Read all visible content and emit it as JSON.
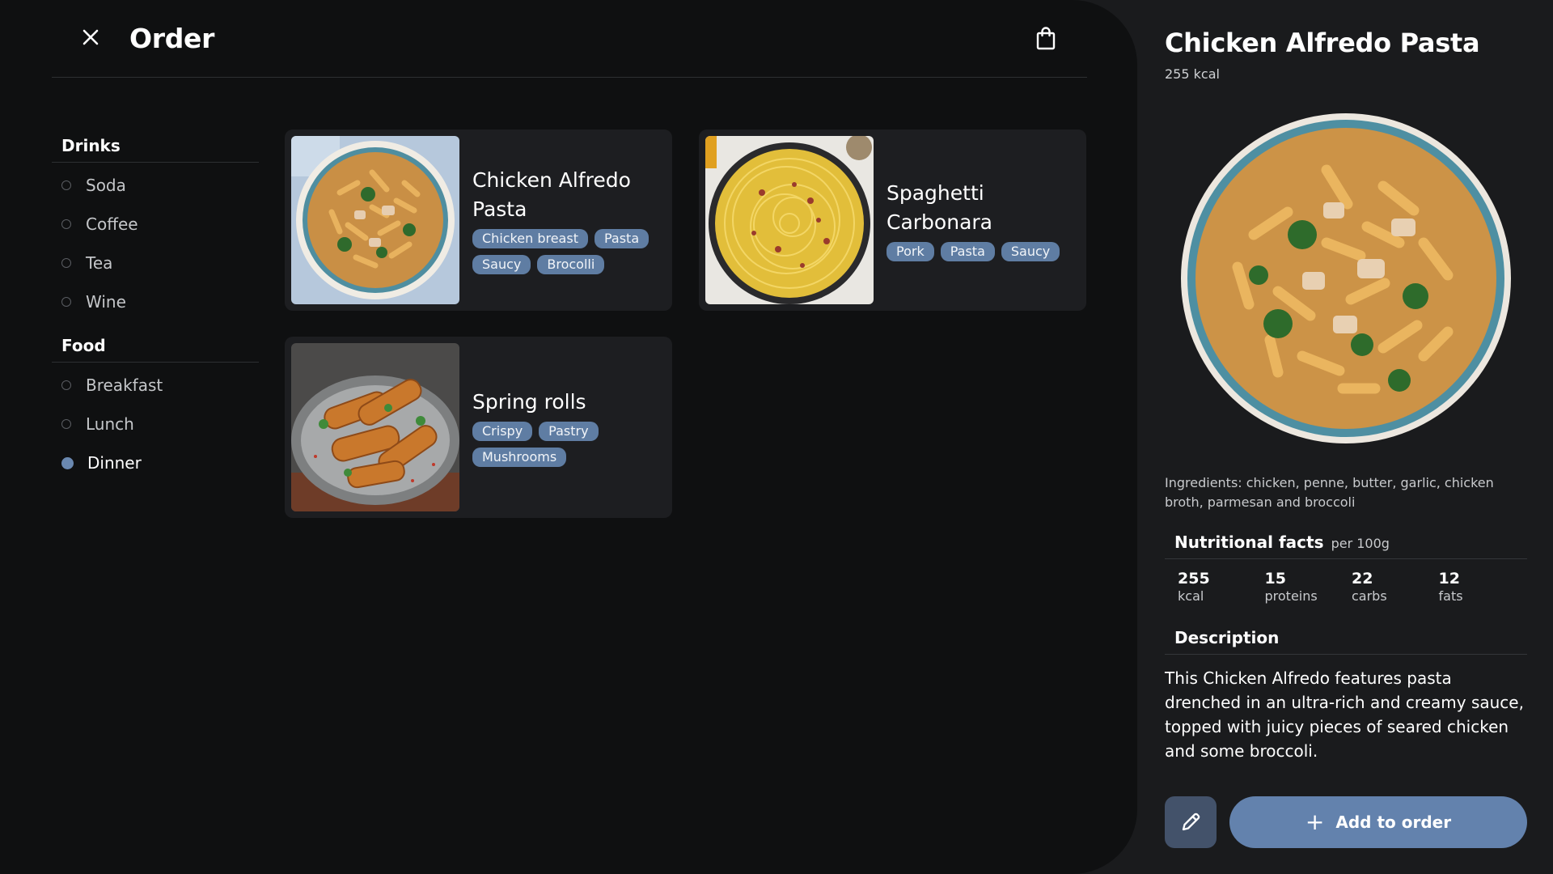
{
  "header": {
    "title": "Order"
  },
  "sidebar": {
    "groups": [
      {
        "heading": "Drinks",
        "items": [
          "Soda",
          "Coffee",
          "Tea",
          "Wine"
        ]
      },
      {
        "heading": "Food",
        "items": [
          "Breakfast",
          "Lunch",
          "Dinner"
        ]
      }
    ],
    "selected": "Dinner"
  },
  "menu": {
    "items": [
      {
        "name": "Chicken Alfredo Pasta",
        "tags": [
          "Chicken breast",
          "Pasta",
          "Saucy",
          "Brocolli"
        ]
      },
      {
        "name": "Spaghetti Carbonara",
        "tags": [
          "Pork",
          "Pasta",
          "Saucy"
        ]
      },
      {
        "name": "Spring rolls",
        "tags": [
          "Crispy",
          "Pastry",
          "Mushrooms"
        ]
      }
    ]
  },
  "detail": {
    "title": "Chicken Alfredo Pasta",
    "kcal": "255 kcal",
    "ingredients": "Ingredients: chicken, penne, butter, garlic, chicken broth, parmesan and broccoli",
    "nutrition_title": "Nutritional facts",
    "nutrition_unit": "per 100g",
    "nutrition": [
      {
        "value": "255",
        "label": "kcal"
      },
      {
        "value": "15",
        "label": "proteins"
      },
      {
        "value": "22",
        "label": "carbs"
      },
      {
        "value": "12",
        "label": "fats"
      }
    ],
    "description_title": "Description",
    "description": "This Chicken Alfredo features pasta drenched in an ultra-rich and creamy sauce, topped with juicy pieces of seared chicken and some broccoli.",
    "add_label": "Add to order"
  },
  "icons": {
    "close": "close-icon",
    "bag": "shopping-bag-icon",
    "edit": "pencil-icon",
    "plus": "plus-icon"
  },
  "colors": {
    "background": "#0f1011",
    "panel": "#1a1b1d",
    "card": "#1d1e21",
    "accent": "#6382ad",
    "tag": "#5f7da3"
  }
}
